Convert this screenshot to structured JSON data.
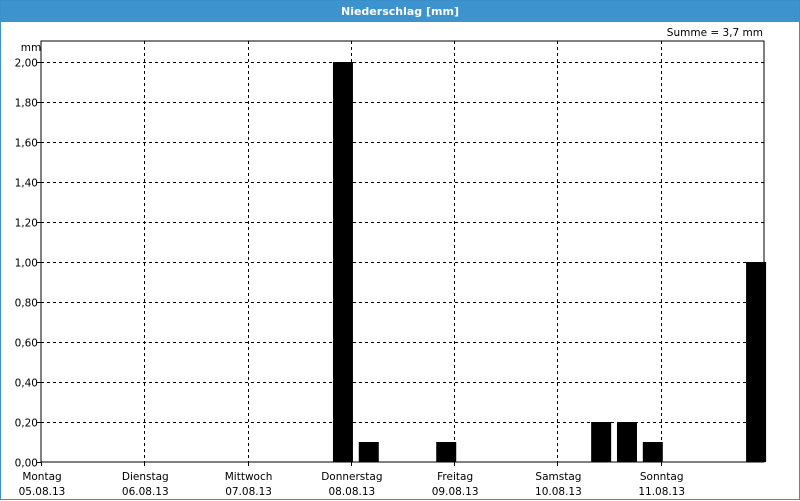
{
  "title": "Niederschlag [mm]",
  "summary": "Summe = 3,7 mm",
  "colors": {
    "titlebar": "#3c93cd",
    "bars": "#000000",
    "grid": "#000000"
  },
  "chart_data": {
    "type": "bar",
    "title": "Niederschlag [mm]",
    "ylabel": "mm",
    "ylim": [
      0,
      2.0
    ],
    "yticks": [
      "0,00",
      "0,20",
      "0,40",
      "0,60",
      "0,80",
      "1,00",
      "1,20",
      "1,40",
      "1,60",
      "1,80",
      "2,00"
    ],
    "grid": true,
    "days": [
      {
        "name": "Montag",
        "date": "05.08.13"
      },
      {
        "name": "Dienstag",
        "date": "06.08.13"
      },
      {
        "name": "Mittwoch",
        "date": "07.08.13"
      },
      {
        "name": "Donnerstag",
        "date": "08.08.13"
      },
      {
        "name": "Freitag",
        "date": "09.08.13"
      },
      {
        "name": "Samstag",
        "date": "10.08.13"
      },
      {
        "name": "Sonntag",
        "date": "11.08.13"
      }
    ],
    "series": [
      {
        "bars": [
          {
            "day": 2,
            "hour": 18,
            "value": 2.0
          },
          {
            "day": 3,
            "hour": 0,
            "value": 0.1
          },
          {
            "day": 3,
            "hour": 18,
            "value": 0.1
          },
          {
            "day": 5,
            "hour": 6,
            "value": 0.2
          },
          {
            "day": 5,
            "hour": 12,
            "value": 0.2
          },
          {
            "day": 5,
            "hour": 18,
            "value": 0.1
          },
          {
            "day": 6,
            "hour": 18,
            "value": 1.0
          }
        ]
      }
    ]
  }
}
